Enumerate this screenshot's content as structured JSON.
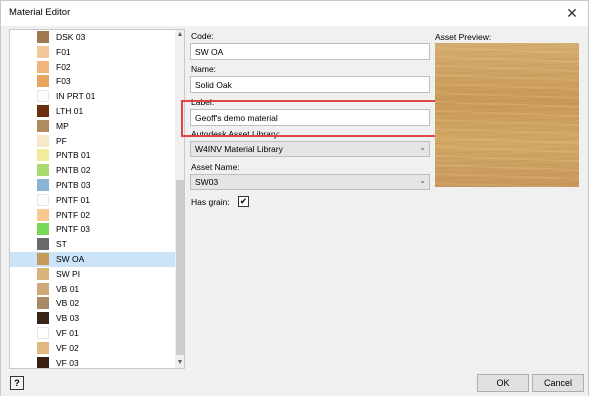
{
  "window": {
    "title": "Material Editor",
    "close_glyph": "✕"
  },
  "materials": [
    {
      "label": "DSK 03",
      "color": "#a07850"
    },
    {
      "label": "F01",
      "color": "#f2c89a"
    },
    {
      "label": "F02",
      "color": "#f0b57d"
    },
    {
      "label": "F03",
      "color": "#e9a560"
    },
    {
      "label": "IN PRT 01",
      "color": "#ffffff"
    },
    {
      "label": "LTH 01",
      "color": "#6a3010"
    },
    {
      "label": "MP",
      "color": "#b08a60"
    },
    {
      "label": "PF",
      "color": "#f6e8c8"
    },
    {
      "label": "PNTB 01",
      "color": "#f2ec9a"
    },
    {
      "label": "PNTB 02",
      "color": "#a8d870"
    },
    {
      "label": "PNTB 03",
      "color": "#8ab4d6"
    },
    {
      "label": "PNTF 01",
      "color": "#ffffff"
    },
    {
      "label": "PNTF 02",
      "color": "#f8c890"
    },
    {
      "label": "PNTF 03",
      "color": "#78d858"
    },
    {
      "label": "ST",
      "color": "#6a6a6a"
    },
    {
      "label": "SW OA",
      "color": "#c49a5a"
    },
    {
      "label": "SW PI",
      "color": "#d8b47a"
    },
    {
      "label": "VB 01",
      "color": "#cfa97a"
    },
    {
      "label": "VB 02",
      "color": "#a88a68"
    },
    {
      "label": "VB 03",
      "color": "#3a2418"
    },
    {
      "label": "VF 01",
      "color": "#ffffff"
    },
    {
      "label": "VF 02",
      "color": "#e0b880"
    },
    {
      "label": "VF 03",
      "color": "#3a2010"
    }
  ],
  "selected_index": 15,
  "scrollbar": {
    "up_glyph": "▲",
    "down_glyph": "▼"
  },
  "form": {
    "code_label": "Code:",
    "code_value": "SW OA",
    "name_label": "Name:",
    "name_value": "Solid Oak",
    "label_label": "Label:",
    "label_value": "Geoff's demo material",
    "library_label": "Autodesk Asset Library:",
    "library_value": "W4INV Material Library",
    "asset_name_label": "Asset Name:",
    "asset_name_value": "SW03",
    "has_grain_label": "Has grain:",
    "has_grain_checked": true,
    "check_glyph": "✔",
    "dropdown_glyph": "⌄"
  },
  "preview": {
    "label": "Asset Preview:"
  },
  "footer": {
    "help_glyph": "?",
    "ok_label": "OK",
    "cancel_label": "Cancel"
  },
  "colors": {
    "highlight": "#e04545",
    "selection": "#cce4f7"
  }
}
